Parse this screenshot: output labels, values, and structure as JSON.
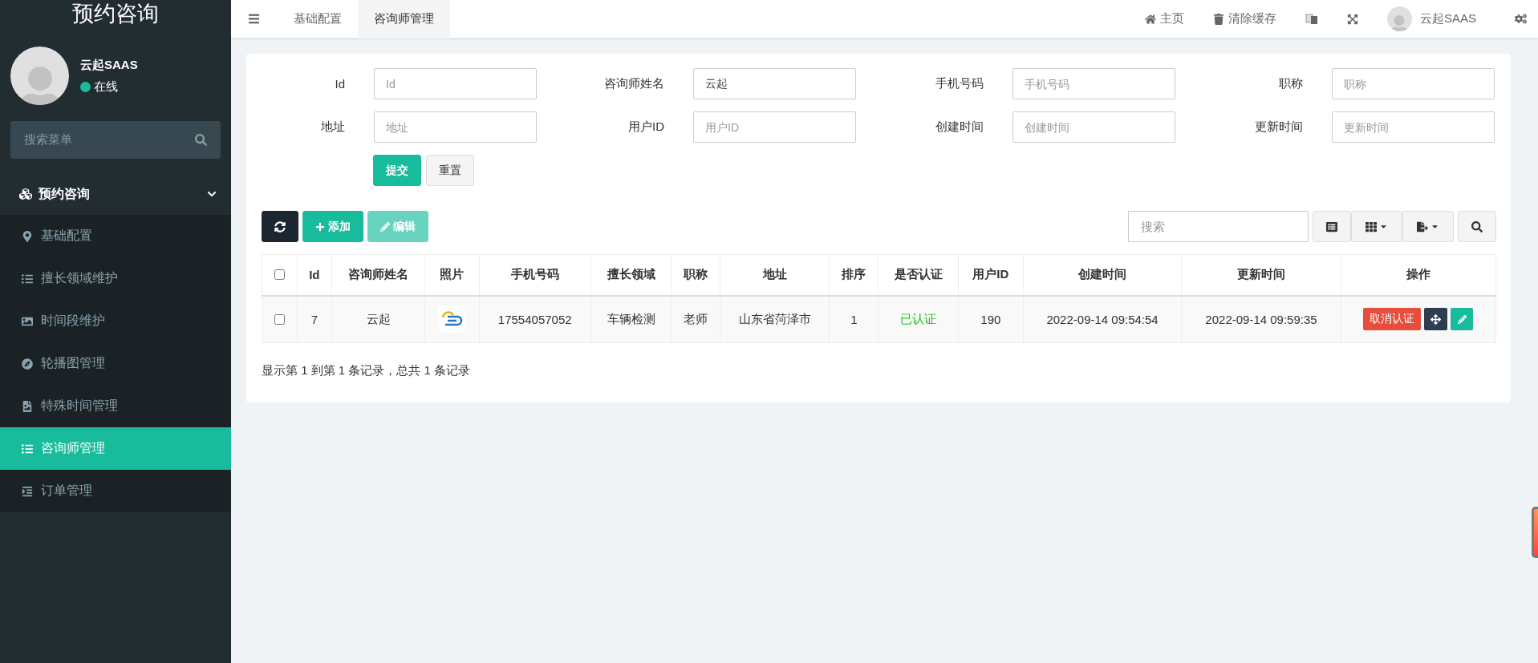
{
  "sidebar": {
    "title": "预约咨询",
    "user": {
      "name": "云起SAAS",
      "status": "在线",
      "online": true
    },
    "search": {
      "placeholder": "搜索菜单"
    },
    "group": {
      "label": "预约咨询",
      "expanded": true
    },
    "items": [
      {
        "label": "基础配置",
        "selected": false
      },
      {
        "label": "擅长领域维护",
        "selected": false
      },
      {
        "label": "时间段维护",
        "selected": false
      },
      {
        "label": "轮播图管理",
        "selected": false
      },
      {
        "label": "特殊时间管理",
        "selected": false
      },
      {
        "label": "咨询师管理",
        "selected": true
      },
      {
        "label": "订单管理",
        "selected": false
      }
    ]
  },
  "topbar": {
    "tabs": [
      {
        "label": "基础配置",
        "selected": false
      },
      {
        "label": "咨询师管理",
        "selected": true
      }
    ],
    "links": [
      "主页",
      "清除缓存"
    ],
    "user": "云起SAAS"
  },
  "form": {
    "fields": [
      {
        "label": "Id",
        "placeholder": "Id"
      },
      {
        "label": "咨询师姓名",
        "value": "云起"
      },
      {
        "label": "手机号码",
        "placeholder": "手机号码"
      },
      {
        "label": "职称",
        "placeholder": "职称"
      },
      {
        "label": "地址",
        "placeholder": "地址"
      },
      {
        "label": "用户ID",
        "placeholder": "用户ID"
      },
      {
        "label": "创建时间",
        "placeholder": "创建时间"
      },
      {
        "label": "更新时间",
        "placeholder": "更新时间"
      }
    ],
    "submit": "提交",
    "reset": "重置"
  },
  "toolbar": {
    "add": "添加",
    "edit": "编辑",
    "edit_disabled": true,
    "search": {
      "placeholder": "搜索"
    }
  },
  "table": {
    "all_checked": false,
    "columns": [
      "Id",
      "咨询师姓名",
      "照片",
      "手机号码",
      "擅长领域",
      "职称",
      "地址",
      "排序",
      "是否认证",
      "用户ID",
      "创建时间",
      "更新时间",
      "操作"
    ],
    "rows": [
      {
        "checked": false,
        "id": "7",
        "name": "云起",
        "phone": "17554057052",
        "field": "车辆检测",
        "title": "老师",
        "address": "山东省菏泽市",
        "sort": "1",
        "verified": true,
        "status": "已认证",
        "user_id": "190",
        "created": "2022-09-14 09:54:54",
        "updated": "2022-09-14 09:59:35",
        "action": "取消认证"
      }
    ]
  },
  "footer": "显示第 1 到第 1 条记录，总共 1 条记录"
}
